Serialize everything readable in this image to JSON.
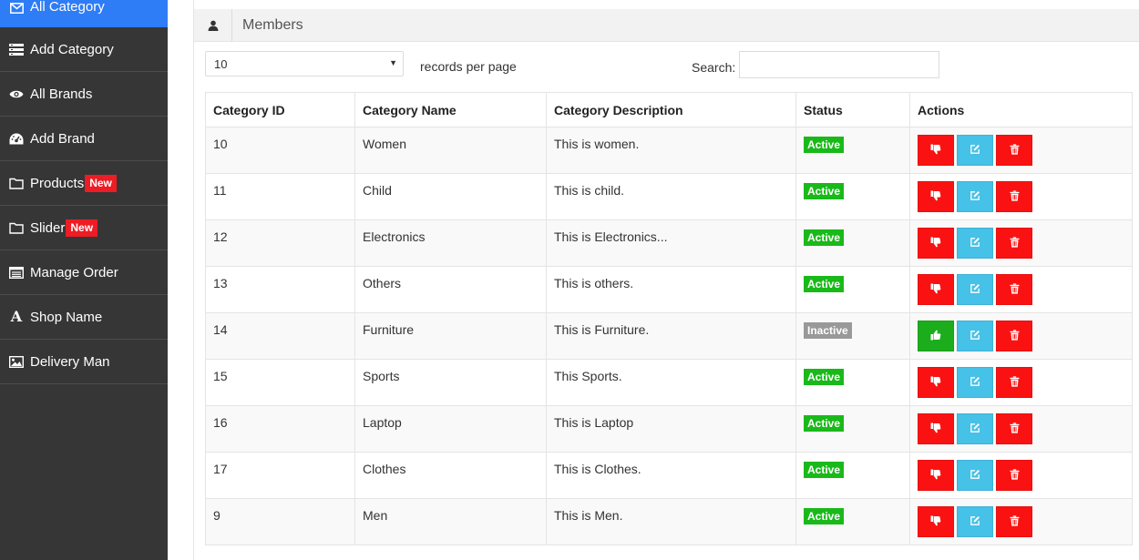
{
  "sidebar": {
    "items": [
      {
        "label": "All Category",
        "icon": "envelope-icon",
        "active": true
      },
      {
        "label": "Add Category",
        "icon": "list-icon"
      },
      {
        "label": "All Brands",
        "icon": "eye-icon"
      },
      {
        "label": "Add Brand",
        "icon": "dashboard-icon"
      },
      {
        "label": "Products",
        "icon": "folder-icon",
        "badge": "New"
      },
      {
        "label": "Slider",
        "icon": "folder-icon",
        "badge": "New"
      },
      {
        "label": "Manage Order",
        "icon": "table-icon"
      },
      {
        "label": "Shop Name",
        "icon": "font-icon"
      },
      {
        "label": "Delivery Man",
        "icon": "picture-icon"
      }
    ]
  },
  "panel": {
    "title": "Members",
    "icon": "user-icon"
  },
  "controls": {
    "records_value": "10",
    "records_label": "records per page",
    "search_label": "Search:",
    "search_value": ""
  },
  "table": {
    "headers": [
      "Category ID",
      "Category Name",
      "Category Description",
      "Status",
      "Actions"
    ],
    "rows": [
      {
        "id": "10",
        "name": "Women",
        "desc": "This is women.",
        "status": "Active"
      },
      {
        "id": "11",
        "name": "Child",
        "desc": "This is child.",
        "status": "Active"
      },
      {
        "id": "12",
        "name": "Electronics",
        "desc": "This is Electronics...",
        "status": "Active"
      },
      {
        "id": "13",
        "name": "Others",
        "desc": "This is others.",
        "status": "Active"
      },
      {
        "id": "14",
        "name": "Furniture",
        "desc": "This is Furniture.",
        "status": "Inactive"
      },
      {
        "id": "15",
        "name": "Sports",
        "desc": "This Sports.",
        "status": "Active"
      },
      {
        "id": "16",
        "name": "Laptop",
        "desc": "This is Laptop",
        "status": "Active"
      },
      {
        "id": "17",
        "name": "Clothes",
        "desc": "This is Clothes.",
        "status": "Active"
      },
      {
        "id": "9",
        "name": "Men",
        "desc": "This is Men.",
        "status": "Active"
      }
    ]
  },
  "colors": {
    "sidebar_bg": "#363636",
    "active_item": "#2e7cf6",
    "badge_new": "#ee1c24",
    "status_active": "#1ab91a",
    "status_inactive": "#999999",
    "btn_deactivate": "#fa1212",
    "btn_activate": "#1cad1c",
    "btn_edit": "#46c1e8",
    "btn_delete": "#fa1212"
  }
}
